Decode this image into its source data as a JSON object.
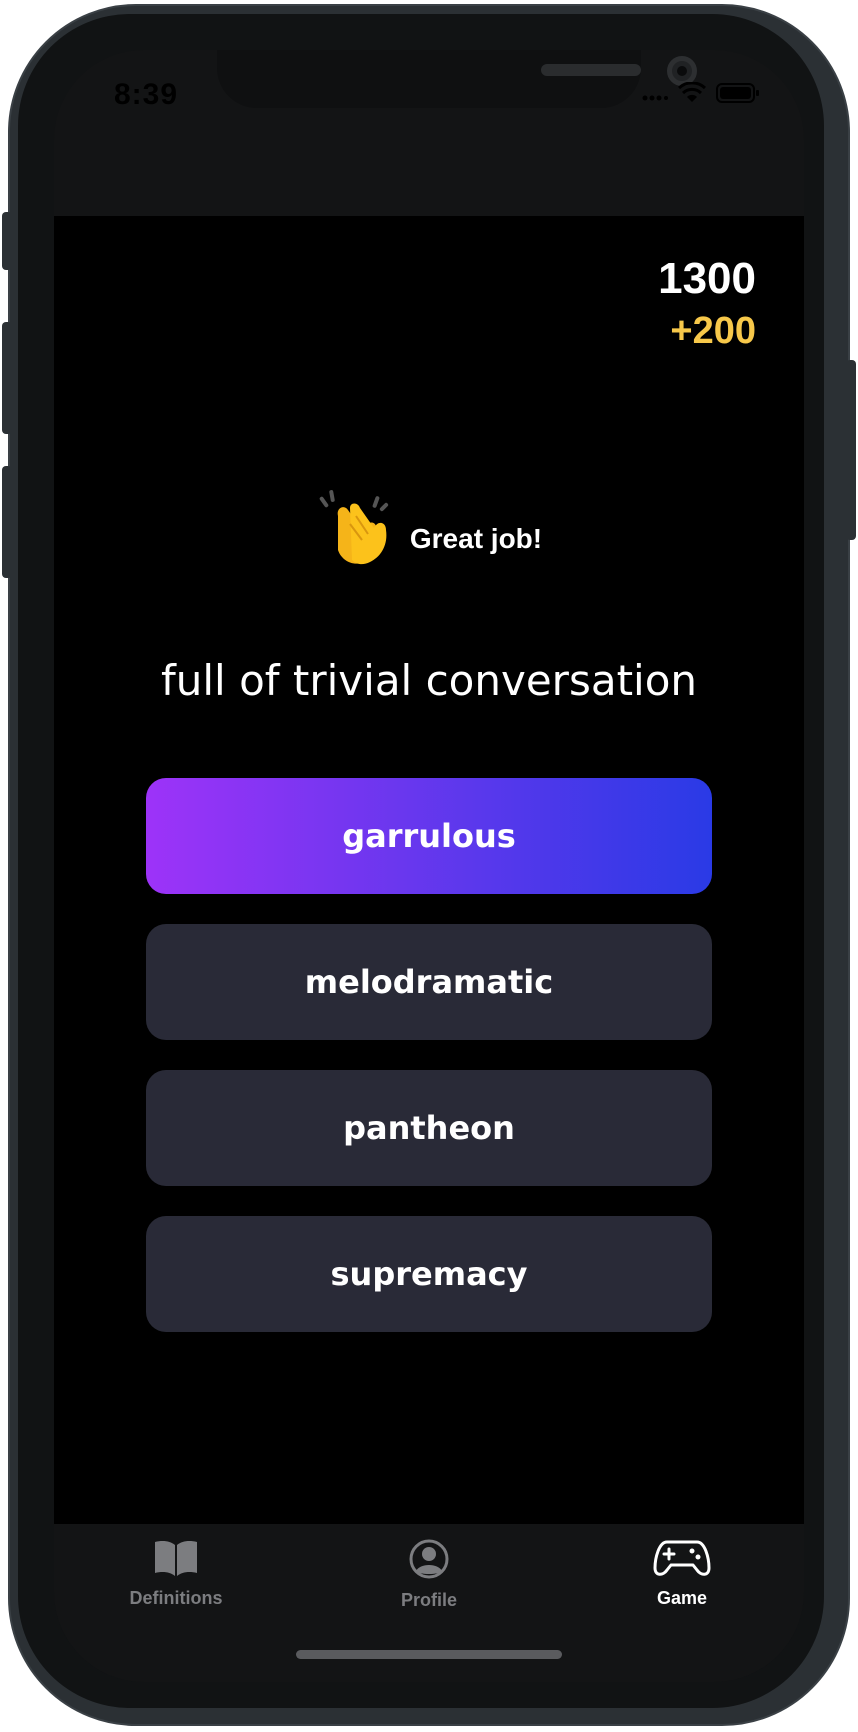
{
  "status_bar": {
    "time": "8:39"
  },
  "game": {
    "score": "1300",
    "bonus": "+200",
    "feedback_emoji": "clapping-hands-icon",
    "feedback_text": "Great job!",
    "definition": "full of trivial conversation",
    "options": [
      {
        "label": "garrulous",
        "selected": true
      },
      {
        "label": "melodramatic",
        "selected": false
      },
      {
        "label": "pantheon",
        "selected": false
      },
      {
        "label": "supremacy",
        "selected": false
      }
    ]
  },
  "tabs": [
    {
      "label": "Definitions",
      "icon": "book-icon",
      "active": false
    },
    {
      "label": "Profile",
      "icon": "profile-icon",
      "active": false
    },
    {
      "label": "Game",
      "icon": "gamepad-icon",
      "active": true
    }
  ],
  "colors": {
    "bonus": "#f7c84a",
    "option_bg": "#292a37",
    "gradient_start": "#9d33f8",
    "gradient_end": "#2a3ae6"
  }
}
